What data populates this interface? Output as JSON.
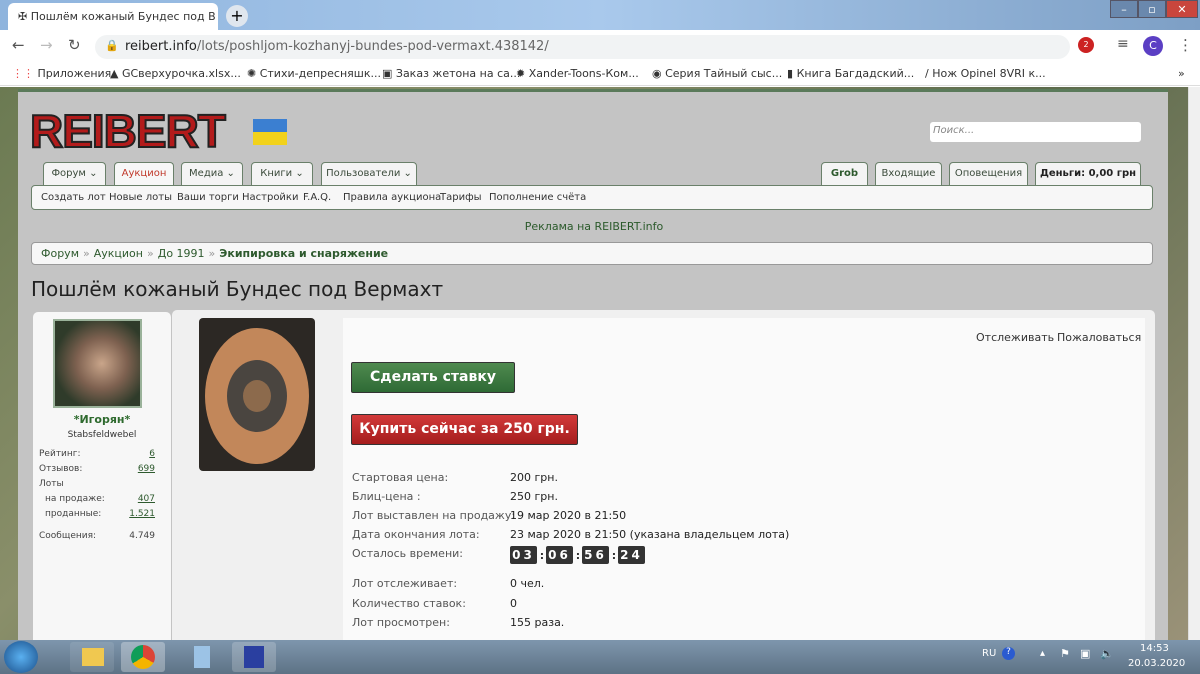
{
  "browser": {
    "tab_title": "Пошлём кожаный Бундес под В",
    "url_domain": "reibert.info",
    "url_path": "/lots/poshljom-kozhanyj-bundes-pod-vermaxt.438142/",
    "ext_badge": "2",
    "profile": "C"
  },
  "bookmarks": [
    "Приложения",
    "GCверхурочка.xlsx...",
    "Стихи-депресняшк...",
    "Заказ жетона на са...",
    "Xander-Toons-Ком...",
    "Серия Тайный сыс...",
    "Книга Багдадский...",
    "Нож Opinel 8VRI к..."
  ],
  "site": {
    "logo": "REIBERT.info",
    "search_placeholder": "Поиск...",
    "nav": [
      "Форум",
      "Аукцион",
      "Медиа",
      "Книги",
      "Пользователи"
    ],
    "user_nav": [
      "Grob",
      "Входящие",
      "Оповещения",
      "Деньги: 0,00 грн"
    ],
    "subnav": [
      "Создать лот",
      "Новые лоты",
      "Ваши торги",
      "Настройки",
      "F.A.Q.",
      "Правила аукциона",
      "Тарифы",
      "Пополнение счёта"
    ],
    "ad": "Реклама на REIBERT.info",
    "breadcrumbs": [
      "Форум",
      "Аукцион",
      "До 1991",
      "Экипировка и снаряжение"
    ]
  },
  "page_title": "Пошлём кожаный Бундес под Вермахт",
  "user": {
    "name": "*Игорян*",
    "rank": "Stabsfeldwebel",
    "rating_label": "Рейтинг:",
    "rating": "6",
    "reviews_label": "Отзывов:",
    "reviews": "699",
    "lots_label": "Лоты",
    "selling_label": "на продаже:",
    "selling": "407",
    "sold_label": "проданные:",
    "sold": "1.521",
    "posts_label": "Сообщения:",
    "posts": "4.749"
  },
  "lot": {
    "watch": "Отслеживать",
    "report": "Пожаловаться",
    "bid_button": "Сделать ставку",
    "buy_button": "Купить сейчас за 250 грн.",
    "rows": [
      {
        "label": "Стартовая цена:",
        "value": "200 грн."
      },
      {
        "label": "Блиц-цена :",
        "value": "250 грн."
      },
      {
        "label": "Лот выставлен на продажу:",
        "value": "19 мар 2020 в 21:50"
      },
      {
        "label": "Дата окончания лота:",
        "value": "23 мар 2020 в 21:50 (указана владельцем лота)"
      }
    ],
    "time_left_label": "Осталось времени:",
    "time_left": [
      "03",
      "06",
      "56",
      "24"
    ],
    "rows2": [
      {
        "label": "Лот отслеживает:",
        "value": "0 чел."
      },
      {
        "label": "Количество ставок:",
        "value": "0"
      },
      {
        "label": "Лот просмотрен:",
        "value": "155 раза."
      }
    ]
  },
  "taskbar": {
    "lang": "RU",
    "time": "14:53",
    "date": "20.03.2020"
  }
}
